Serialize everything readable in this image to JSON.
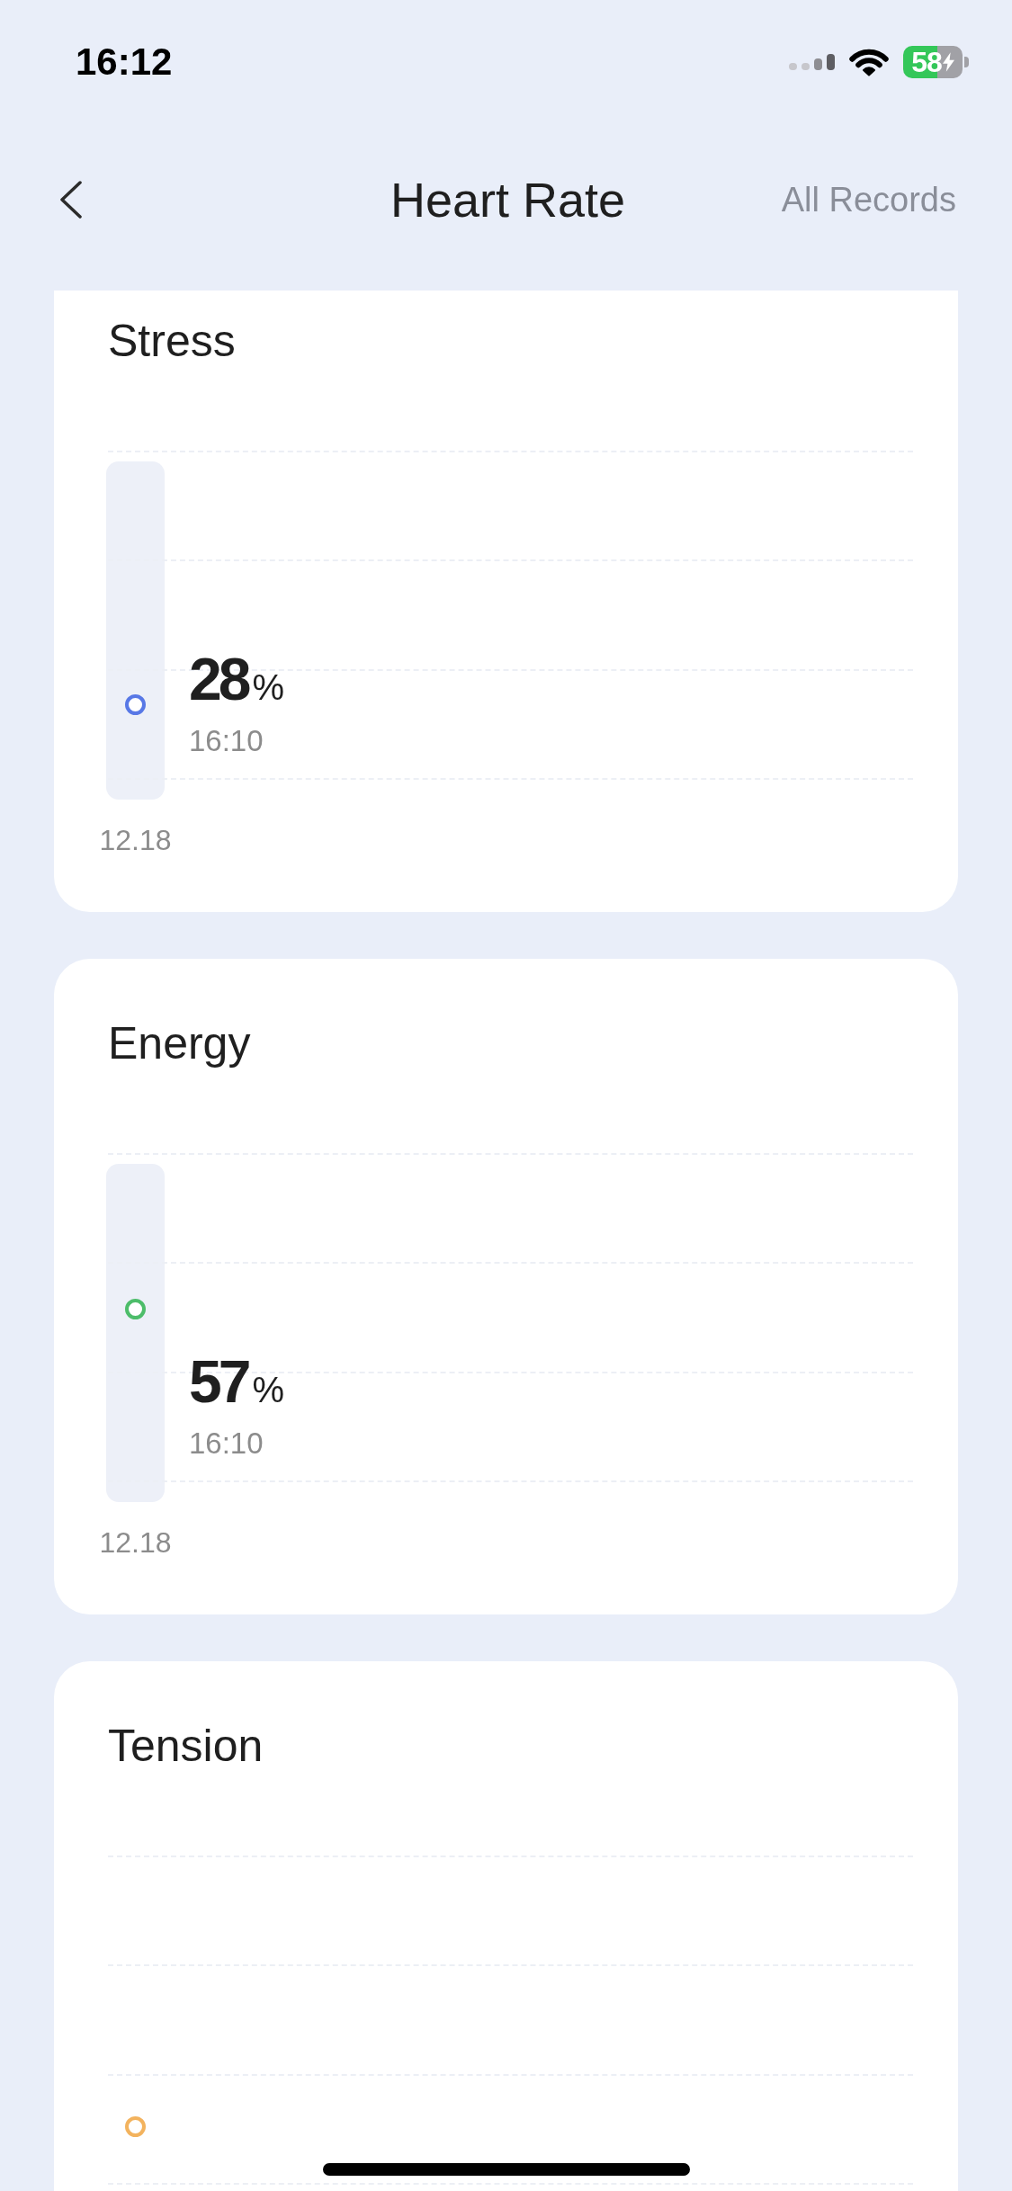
{
  "status_bar": {
    "time": "16:12",
    "battery": "58"
  },
  "nav": {
    "title": "Heart Rate",
    "action": "All Records"
  },
  "cards": [
    {
      "title": "Stress",
      "x_label": "12.18",
      "point": {
        "color": "#5878e6",
        "level": 0.28,
        "selected": true,
        "value": "28",
        "unit": "%",
        "time": "16:10"
      }
    },
    {
      "title": "Energy",
      "x_label": "12.18",
      "point": {
        "color": "#4dbd6a",
        "level": 0.57,
        "selected": true,
        "value": "57",
        "unit": "%",
        "time": "16:10"
      }
    },
    {
      "title": "Tension",
      "point": {
        "color": "#f3b35e",
        "level": 0.23,
        "selected": false
      }
    }
  ]
}
